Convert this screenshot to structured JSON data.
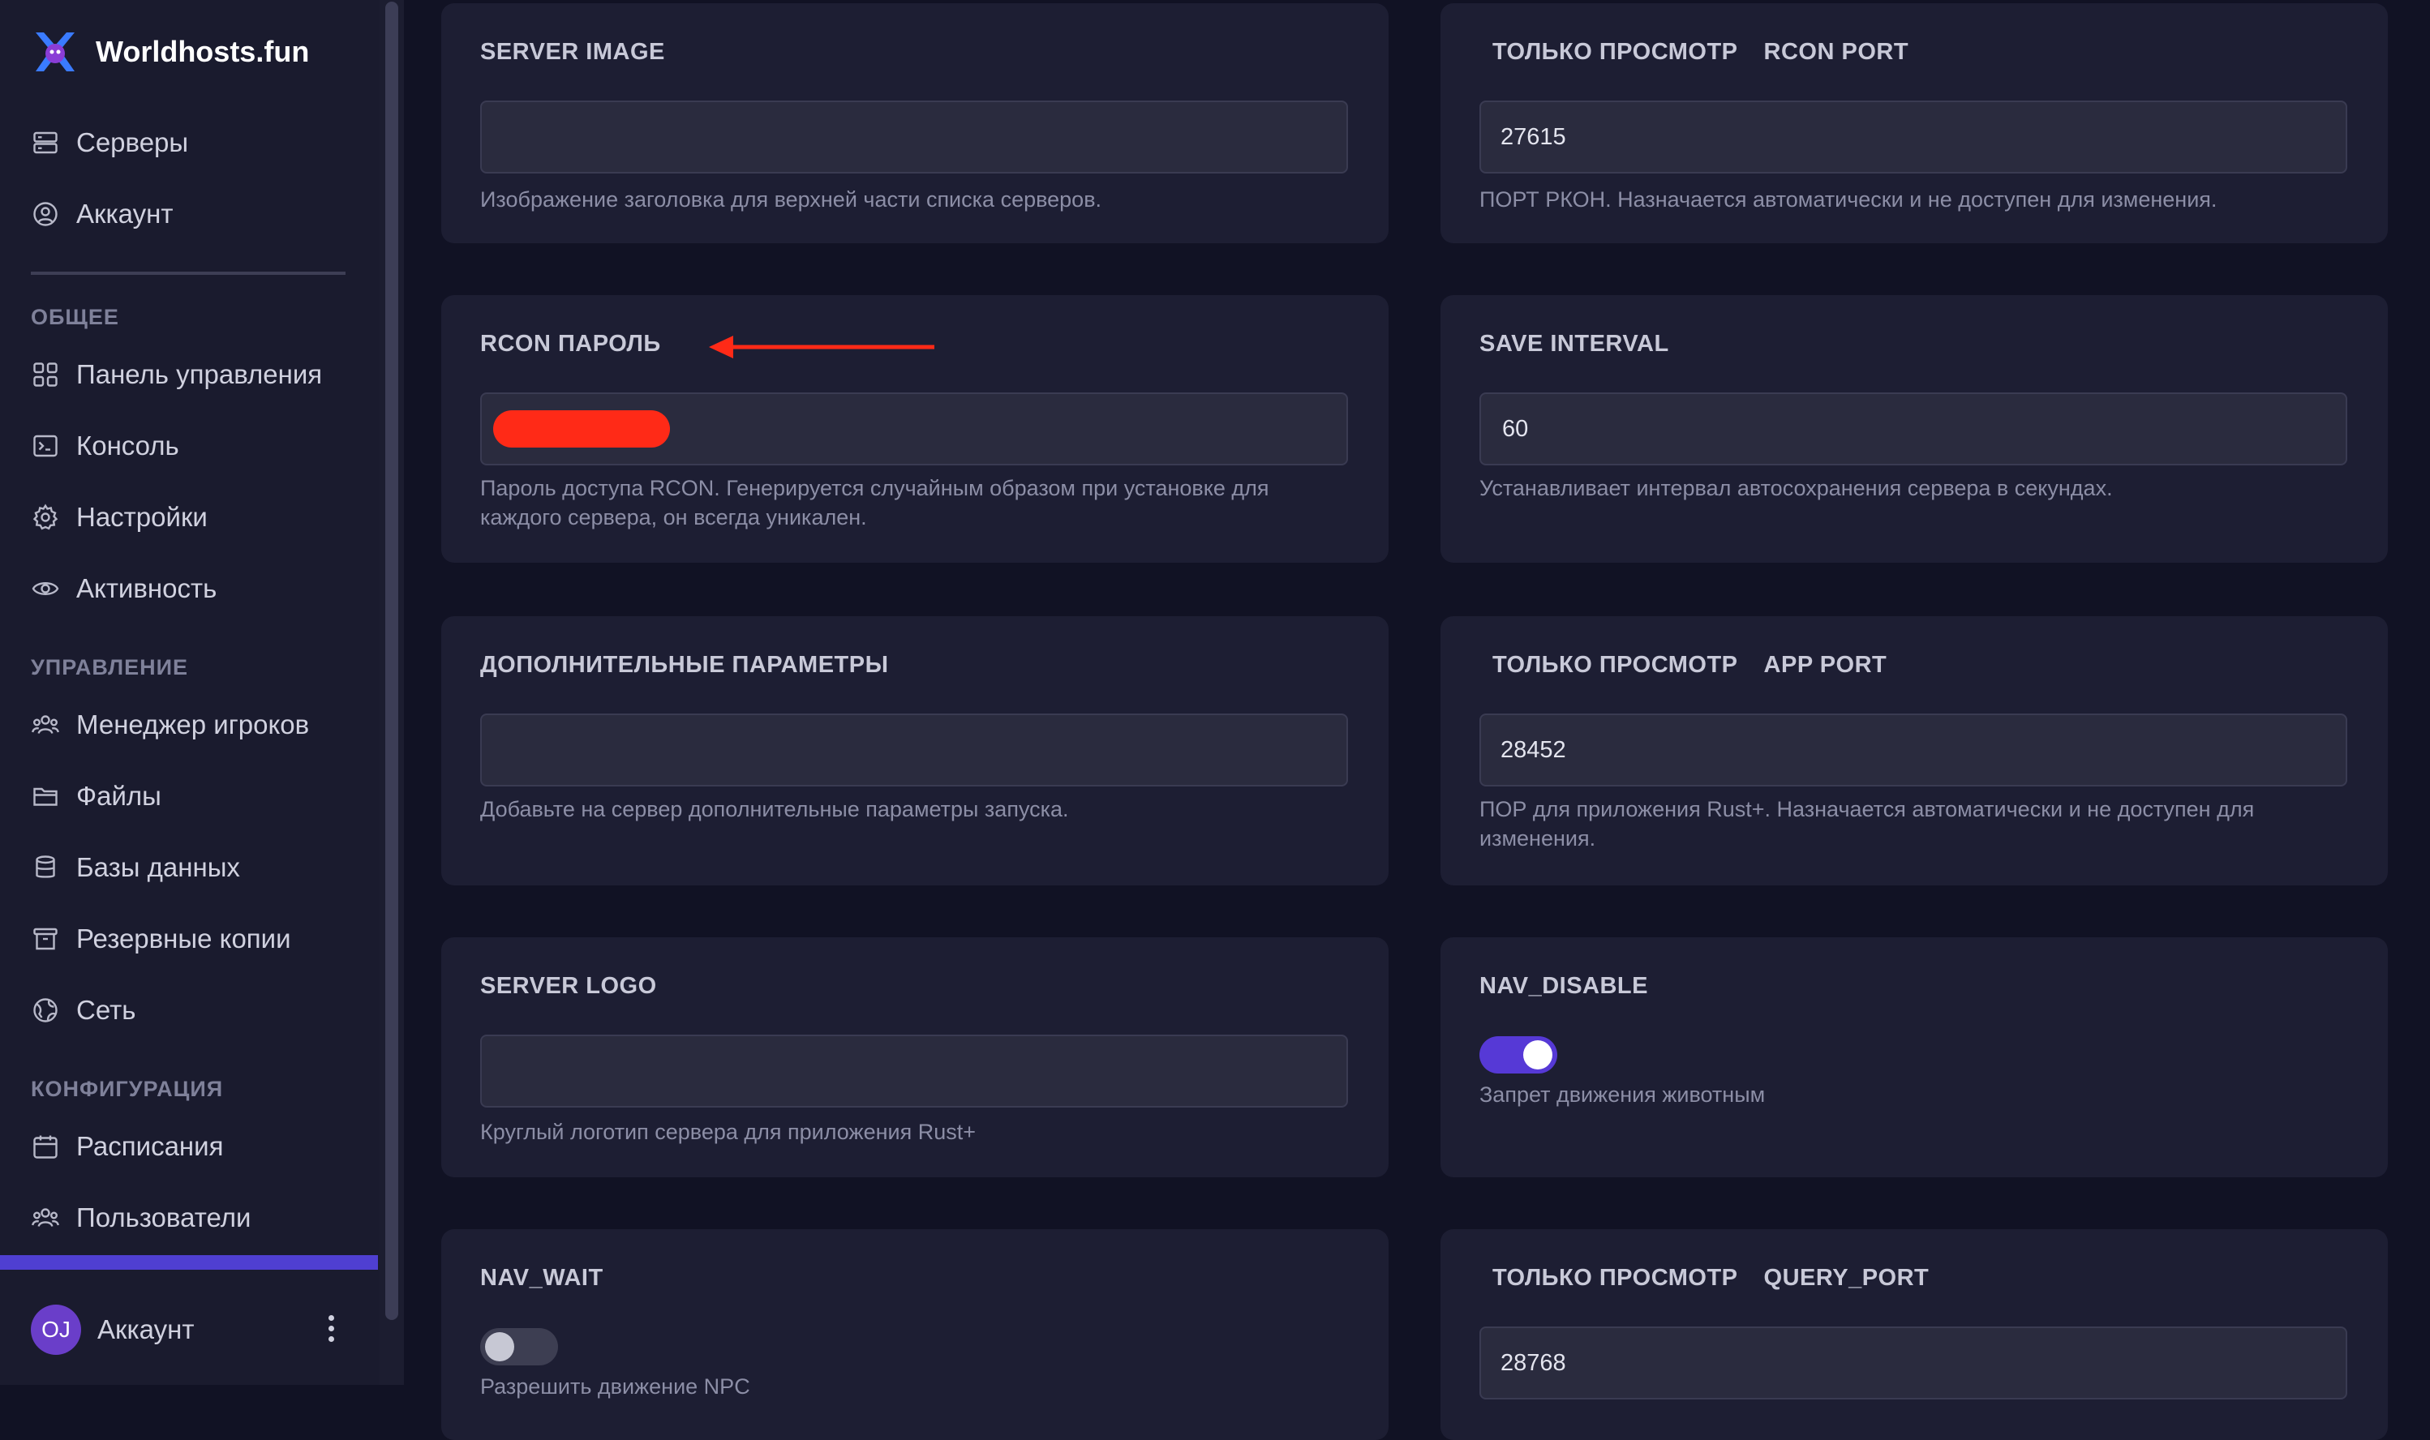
{
  "brand": {
    "name": "Worldhosts.fun"
  },
  "sidebar": {
    "top_items": [
      {
        "label": "Серверы",
        "icon": "server-icon"
      },
      {
        "label": "Аккаунт",
        "icon": "user-circle-icon"
      }
    ],
    "sections": [
      {
        "title": "ОБЩЕЕ",
        "items": [
          {
            "label": "Панель управления",
            "icon": "dashboard-icon"
          },
          {
            "label": "Консоль",
            "icon": "terminal-icon"
          },
          {
            "label": "Настройки",
            "icon": "gear-icon"
          },
          {
            "label": "Активность",
            "icon": "eye-icon"
          }
        ]
      },
      {
        "title": "УПРАВЛЕНИЕ",
        "items": [
          {
            "label": "Менеджер игроков",
            "icon": "users-icon"
          },
          {
            "label": "Файлы",
            "icon": "folder-icon"
          },
          {
            "label": "Базы данных",
            "icon": "database-icon"
          },
          {
            "label": "Резервные копии",
            "icon": "archive-icon"
          },
          {
            "label": "Сеть",
            "icon": "globe-icon"
          }
        ]
      },
      {
        "title": "КОНФИГУРАЦИЯ",
        "items": [
          {
            "label": "Расписания",
            "icon": "calendar-icon"
          },
          {
            "label": "Пользователи",
            "icon": "users-icon"
          }
        ]
      }
    ],
    "footer": {
      "initials": "OJ",
      "label": "Аккаунт"
    }
  },
  "readonly_label": "ТОЛЬКО ПРОСМОТР",
  "cards": {
    "server_image": {
      "title": "SERVER IMAGE",
      "value": "",
      "help": "Изображение заголовка для верхней части списка серверов."
    },
    "rcon_port": {
      "title": "RCON PORT",
      "value": "27615",
      "help": "ПОРТ РКОН. Назначается автоматически и не доступен для изменения."
    },
    "rcon_password": {
      "title": "RCON ПАРОЛЬ",
      "help": "Пароль доступа RCON. Генерируется случайным образом при установке для каждого сервера, он всегда уникален."
    },
    "save_interval": {
      "title": "SAVE INTERVAL",
      "value": "60",
      "help": "Устанавливает интервал автосохранения сервера в секундах."
    },
    "extra_params": {
      "title": "ДОПОЛНИТЕЛЬНЫЕ ПАРАМЕТРЫ",
      "value": "",
      "help": "Добавьте на сервер дополнительные параметры запуска."
    },
    "app_port": {
      "title": "APP PORT",
      "value": "28452",
      "help": "ПОР для приложения Rust+. Назначается автоматически и не доступен для изменения."
    },
    "server_logo": {
      "title": "SERVER LOGO",
      "value": "",
      "help": "Круглый логотип сервера для приложения Rust+"
    },
    "nav_disable": {
      "title": "NAV_DISABLE",
      "enabled": true,
      "help": "Запрет движения животным"
    },
    "nav_wait": {
      "title": "NAV_WAIT",
      "enabled": false,
      "help": "Разрешить движение NPC"
    },
    "query_port": {
      "title": "QUERY_PORT",
      "value": "28768"
    }
  },
  "colors": {
    "accent": "#5639d6",
    "annotation_red": "#ff2a17",
    "background": "#111224",
    "card": "#1d1e33"
  }
}
